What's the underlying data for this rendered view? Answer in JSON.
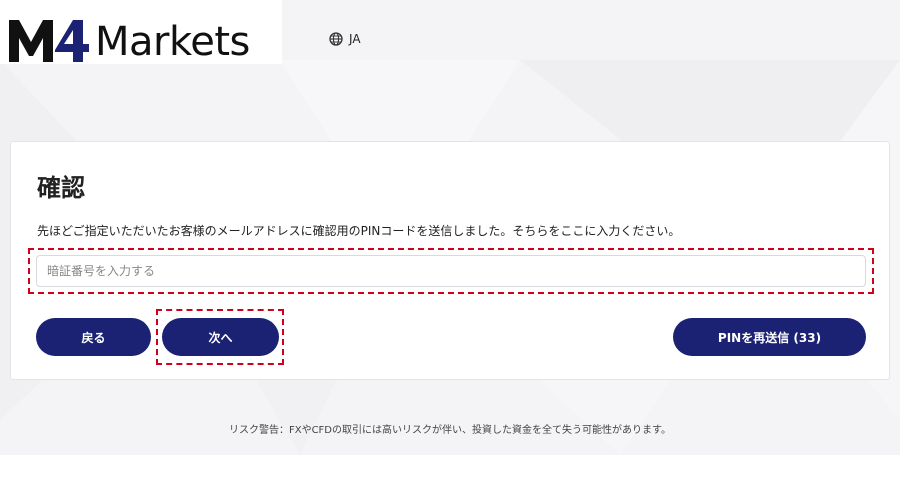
{
  "brand": {
    "logo_text": "Markets",
    "logo_mark": "M4"
  },
  "header": {
    "language_label": "JA",
    "language_icon": "globe-icon"
  },
  "verify": {
    "title": "確認",
    "description": "先ほどご指定いただいたお客様のメールアドレスに確認用のPINコードを送信しました。そちらをここに入力ください。",
    "pin_input": {
      "value": "",
      "placeholder": "暗証番号を入力する"
    },
    "back_label": "戻る",
    "next_label": "次へ",
    "resend_label": "PINを再送信 (33)"
  },
  "footer": {
    "risk_warning": "リスク警告：FXやCFDの取引には高いリスクが伴い、投資した資金を全て失う可能性があります。"
  },
  "colors": {
    "primary_button": "#1b2274",
    "highlight": "#d0021b",
    "logo_accent": "#1b2274"
  }
}
